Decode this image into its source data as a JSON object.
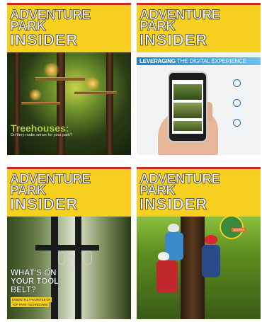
{
  "covers": [
    {
      "masthead": [
        "ADVENTURE",
        "PARK",
        "INSIDER"
      ],
      "headline": "Treehouses:",
      "subheadline": "Do they make sense for your park?"
    },
    {
      "masthead": [
        "ADVENTURE",
        "PARK",
        "INSIDER"
      ],
      "banner_a": "LEVERAGING",
      "banner_b": "THE DIGITAL EXPERIENCE"
    },
    {
      "masthead": [
        "ADVENTURE",
        "PARK",
        "INSIDER"
      ],
      "headline_lines": [
        "WHAT'S ON",
        "YOUR TOOL",
        "BELT?"
      ],
      "sub_lines": [
        "ESSENTIAL FAVORITES OF",
        "TOP PARK TECHNICIANS"
      ]
    },
    {
      "masthead": [
        "ADVENTURE",
        "PARK",
        "INSIDER"
      ],
      "ribbon": "ACCESS"
    }
  ],
  "colors": {
    "brand_yellow": "#f7cf1f",
    "banner_blue": "#1f7fc4",
    "accent_green": "#b8d84a",
    "top_red": "#cf2a1e"
  }
}
